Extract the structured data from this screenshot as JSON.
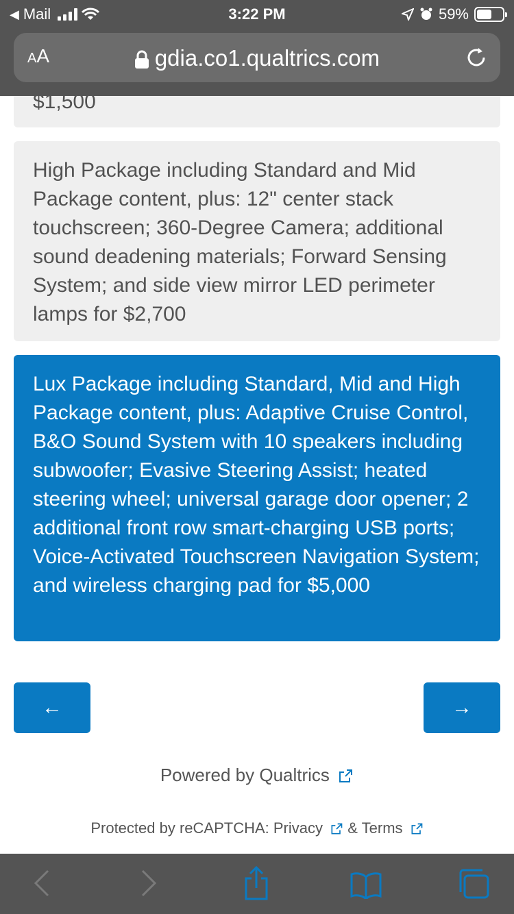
{
  "status": {
    "back_app": "Mail",
    "time": "3:22 PM",
    "battery": "59%"
  },
  "browser": {
    "text_size_label": "AA",
    "url": "gdia.co1.qualtrics.com"
  },
  "options": {
    "previous_tail": "$1,500",
    "high": "High Package including Standard and Mid Package content, plus: 12\" center stack touchscreen; 360-Degree Camera; additional sound deadening materials; Forward Sensing System; and side view mirror LED perimeter lamps for $2,700",
    "lux": "Lux Package including Standard, Mid and High Package content, plus: Adaptive Cruise Control, B&O Sound System with 10 speakers including subwoofer; Evasive Steering Assist; heated steering wheel; universal garage door opener; 2 additional front row smart-charging USB ports; Voice-Activated Touchscreen Navigation System; and wireless charging pad for $5,000"
  },
  "navigation": {
    "back_arrow": "←",
    "next_arrow": "→"
  },
  "footer": {
    "powered_by": "Powered by Qualtrics",
    "protected_by": "Protected by reCAPTCHA: Privacy",
    "and_terms": "& Terms"
  },
  "icons": [
    "back-triangle-icon",
    "signal-icon",
    "wifi-icon",
    "location-icon",
    "alarm-icon",
    "battery-icon",
    "lock-icon",
    "reload-icon",
    "external-link-icon",
    "chevron-left-icon",
    "chevron-right-icon",
    "share-icon",
    "bookmarks-icon",
    "tabs-icon"
  ],
  "colors": {
    "accent": "#0a7ac2",
    "chrome": "#545454",
    "card": "#efefef"
  }
}
